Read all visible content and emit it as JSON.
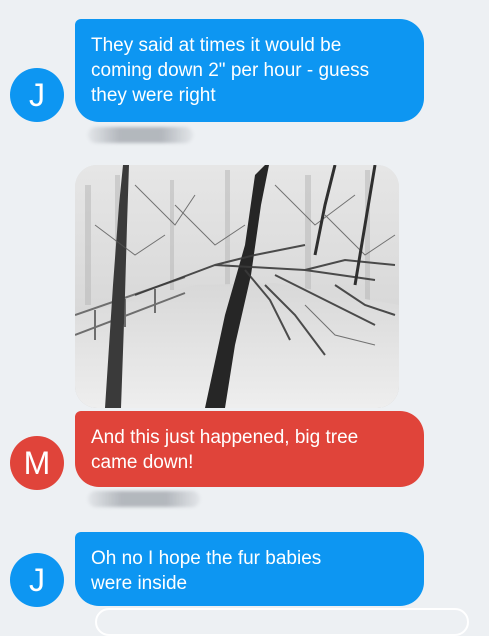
{
  "colors": {
    "background": "#edf0f3",
    "outgoing_j": "#0d96f2",
    "outgoing_m": "#e0443a",
    "avatar_j": "#0d96f2",
    "avatar_m": "#e0443a"
  },
  "messages": [
    {
      "sender_initial": "J",
      "type": "text",
      "text": "They said at times it would be\ncoming down 2\" per hour - guess\nthey were right"
    },
    {
      "sender_initial": "M",
      "type": "image",
      "image_description_icon": "photo-icon"
    },
    {
      "sender_initial": "M",
      "type": "text",
      "text": "And this just happened, big tree\ncame down!"
    },
    {
      "sender_initial": "J",
      "type": "text",
      "text": "Oh no I hope the fur babies\nwere inside"
    }
  ]
}
